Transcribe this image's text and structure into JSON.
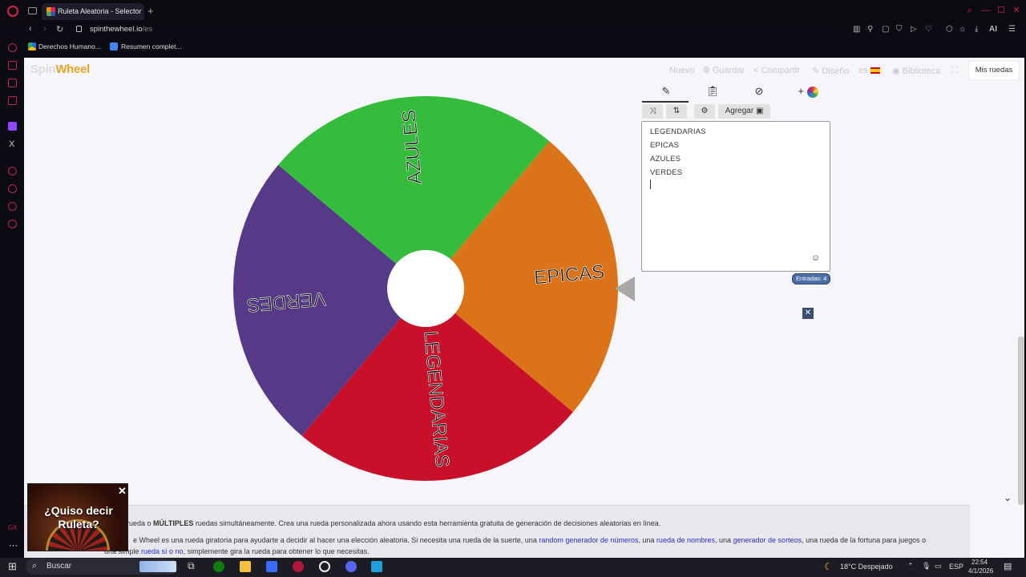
{
  "browser": {
    "tab_title": "Ruleta Aleatoria - Selector",
    "url_domain": "spinthewheel.io",
    "url_path": "/es",
    "bookmarks": [
      "Derechos Humano...",
      "Resumen complet..."
    ]
  },
  "site": {
    "logo": "Spin",
    "logo_accent": "Wheel",
    "nav": {
      "nuevo": "Nuevo",
      "guardar": "Guardar",
      "compartir": "Compartir",
      "diseno": "Diseño",
      "lang": "es",
      "biblioteca": "Biblioteca",
      "mis_ruedas": "Mis ruedas"
    }
  },
  "wheel": {
    "segments": [
      {
        "label": "EPICAS",
        "color": "#db7319"
      },
      {
        "label": "LEGENDARIAS",
        "color": "#c9102a"
      },
      {
        "label": "VERDES",
        "color": "#563a88"
      },
      {
        "label": "AZULES",
        "color": "#36bc3c"
      }
    ]
  },
  "editor": {
    "add_button": "Agregar",
    "plus": "+",
    "entries": [
      "LEGENDARIAS",
      "EPICAS",
      "AZULES",
      "VERDES"
    ],
    "entries_count_label": "Entradas: 4"
  },
  "bottom": {
    "line1_pre": "rueda o ",
    "line1_bold": "MÚLTIPLES",
    "line1_post": " ruedas simultáneamente. Crea una rueda personalizada ahora usando esta herramienta gratuita de generación de decisiones aleatorias en línea.",
    "line2_pre": "e Wheel es una rueda giratoria para ayudarte a decidir al hacer una elección aleatoria. Si necesita una rueda de la suerte, una ",
    "line2_link1": "random generador de números",
    "line2_mid1": ", una ",
    "line2_link2": "rueda de nombres",
    "line2_mid2": ", una ",
    "line2_link3": "generador de sorteos",
    "line2_post": ", una rueda de la fortuna para juegos o",
    "line3_pre": "una simple ",
    "line3_link": "rueda sí o no",
    "line3_post": ", simplemente gira la rueda para obtener lo que necesitas."
  },
  "popup": {
    "line1": "¿Quiso decir",
    "line2": "Ruleta?"
  },
  "taskbar": {
    "search": "Buscar",
    "weather": "18°C  Despejado",
    "lang": "ESP",
    "time": "22:54",
    "date": "4/1/2026"
  }
}
